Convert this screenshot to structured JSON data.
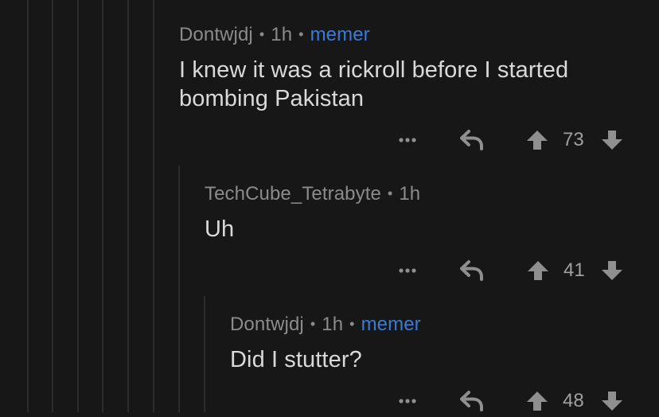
{
  "thread": {
    "comments": [
      {
        "author": "Dontwjdj",
        "time": "1h",
        "flair": "memer",
        "body": "I knew it was a rickroll before I started bombing Pakistan",
        "score": "73"
      },
      {
        "author": "TechCube_Tetrabyte",
        "time": "1h",
        "flair": "",
        "body": "Uh",
        "score": "41"
      },
      {
        "author": "Dontwjdj",
        "time": "1h",
        "flair": "memer",
        "body": "Did I stutter?",
        "score": "48"
      }
    ]
  },
  "icons": {
    "more": "more-options-icon",
    "reply": "reply-icon",
    "upvote": "upvote-icon",
    "downvote": "downvote-icon"
  },
  "colors": {
    "background": "#171717",
    "thread_line": "#2c2c2c",
    "meta_text": "#8b8b8b",
    "body_text": "#d9d9d9",
    "flair": "#3a7bd5",
    "icon": "#8f8f8f"
  }
}
